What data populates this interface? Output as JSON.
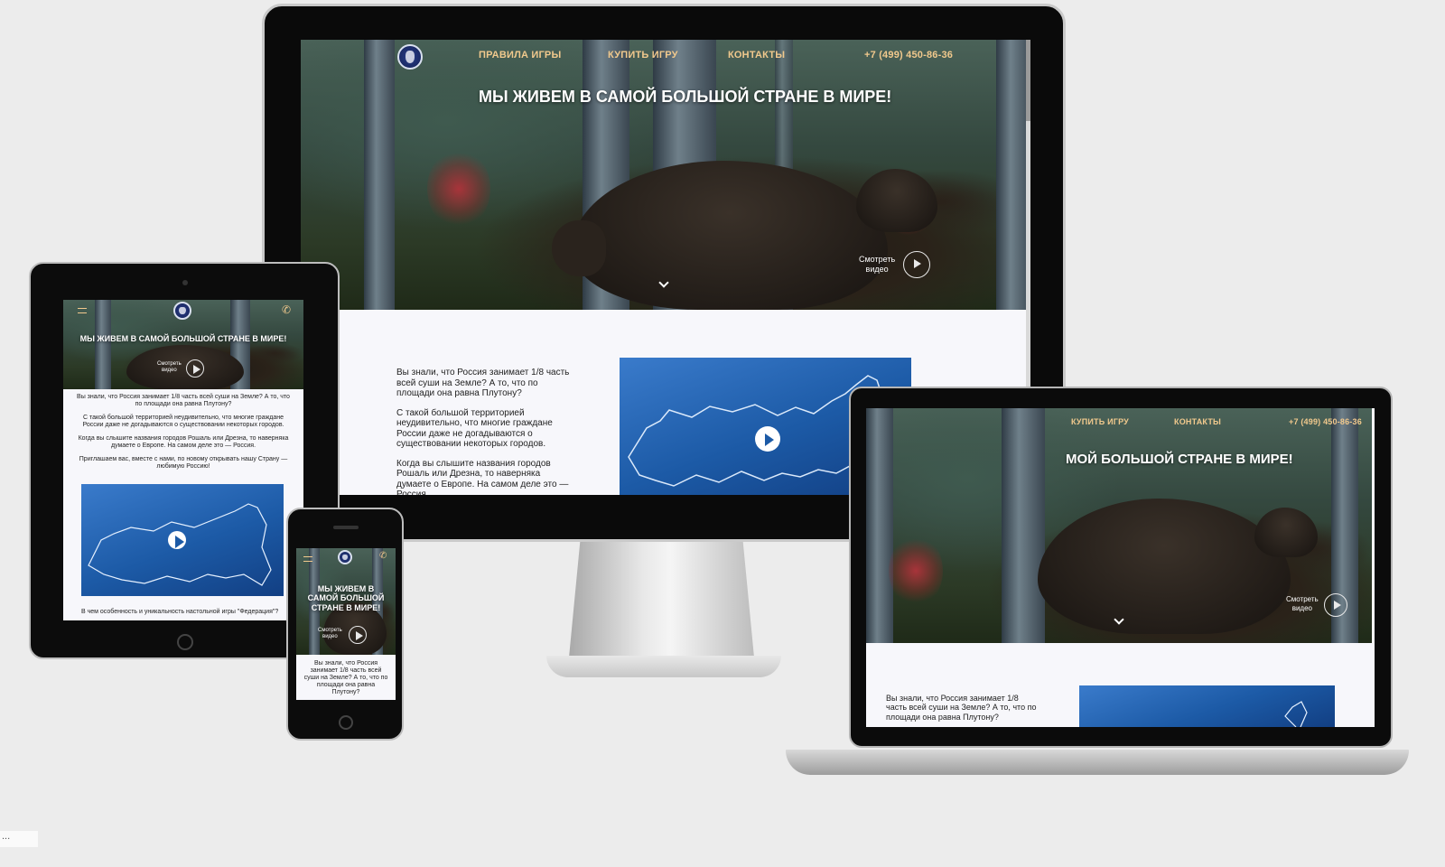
{
  "nav": {
    "rules": "ПРАВИЛА ИГРЫ",
    "buy": "КУПИТЬ ИГРУ",
    "contacts": "КОНТАКТЫ",
    "phone": "+7 (499) 450-86-36"
  },
  "hero": {
    "title": "МЫ ЖИВЕМ В САМОЙ БОЛЬШОЙ СТРАНЕ В МИРЕ!",
    "title_laptop": "МОЙ БОЛЬШОЙ СТРАНЕ В МИРЕ!",
    "watch_line1": "Смотреть",
    "watch_line2": "видео"
  },
  "content": {
    "p1": "Вы знали, что Россия занимает 1/8 часть всей суши на Земле? А то, что по площади она равна Плутону?",
    "p2": "С такой большой территорией неудивительно, что многие граждане России даже не догадываются о существовании некоторых городов.",
    "p3": "Когда вы слышите названия городов Рошаль или Дрезна, то наверняка думаете о Европе. На самом деле это — Россия.",
    "p4": "Приглашаем вас, вместе с нами, по новому открывать нашу Страну — любимую Россию!",
    "p5": "В чем особенность и уникальность настольной игры \"Федерация\"?"
  },
  "phone_screen": {
    "title": "МЫ ЖИВЕМ В САМОЙ БОЛЬШОЙ СТРАНЕ В МИРЕ!"
  },
  "status": {
    "ellipsis": "..."
  },
  "colors": {
    "accent": "#f1c98d",
    "map_blue": "#1c5aa6",
    "background": "#ececec"
  }
}
